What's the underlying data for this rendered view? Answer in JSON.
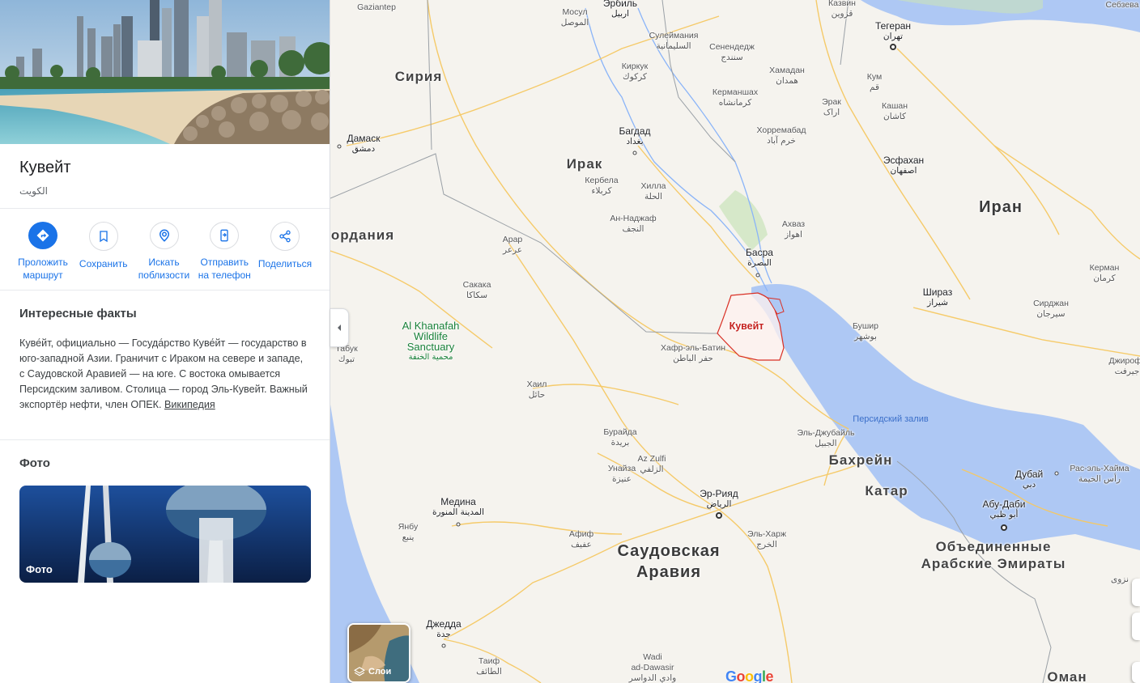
{
  "panel": {
    "title": "Кувейт",
    "subtitle": "الكويت",
    "actions": [
      {
        "label": "Проложить маршрут",
        "icon": "directions-icon"
      },
      {
        "label": "Сохранить",
        "icon": "bookmark-icon"
      },
      {
        "label": "Искать поблизости",
        "icon": "nearby-icon"
      },
      {
        "label": "Отправить на телефон",
        "icon": "send-to-phone-icon"
      },
      {
        "label": "Поделиться",
        "icon": "share-icon"
      }
    ],
    "facts": {
      "title": "Интересные факты",
      "text": "Куве́йт, официально — Госуда́рство Куве́йт — государство в юго-западной Азии. Граничит с Ираком на севере и западе, с Саудовской Аравией — на юге. С востока омывается Персидским заливом. Столица — город Эль-Кувейт. Важный экспортёр нефти, член ОПЕК.",
      "link": "Википедия"
    },
    "photos": {
      "title": "Фото",
      "card_label": "Фото"
    }
  },
  "map": {
    "labels": {
      "gaziantep": "Gaziantep",
      "erbil": "Эрбиль",
      "erbil_ar": "اربيل",
      "mosul": "Мосул",
      "mosul_ar": "الموصل",
      "kazvin": "Казвин",
      "kazvin_ar": "قزوین",
      "sebzevar": "Себзева",
      "syria": "Сирия",
      "suleymaniya": "Сулеймания",
      "suleymaniya_ar": "السليمانية",
      "senendej": "Сенендедж",
      "senendej_ar": "سنندج",
      "tehran": "Тегеран",
      "tehran_ar": "تهران",
      "kirkuk": "Киркук",
      "kirkuk_ar": "كركوك",
      "hamadan": "Хамадан",
      "hamadan_ar": "همدان",
      "kum": "Кум",
      "kum_ar": "قم",
      "kermanshah": "Керманшах",
      "kermanshah_ar": "کرمانشاه",
      "arak": "Эрак",
      "arak_ar": "اراک",
      "kashan": "Кашан",
      "kashan_ar": "کاشان",
      "damascus": "Дамаск",
      "damascus_ar": "دمشق",
      "baghdad": "Багдад",
      "baghdad_ar": "بغداد",
      "khorramabad": "Хорремабад",
      "khorramabad_ar": "خرم آباد",
      "iraq": "Ирак",
      "kerbela": "Кербела",
      "kerbela_ar": "كربلاء",
      "isfahan": "Эсфахан",
      "isfahan_ar": "اصفهان",
      "hilla": "Хилла",
      "hilla_ar": "الحلة",
      "iran": "Иран",
      "najaf": "Ан-Наджаф",
      "najaf_ar": "النجف",
      "ahvaz": "Ахваз",
      "ahvaz_ar": "اهواز",
      "jordan": "ордания",
      "arar": "Арар",
      "arar_ar": "عرعر",
      "basra": "Басра",
      "basra_ar": "البصرة",
      "kerman": "Керман",
      "kerman_ar": "كرمان",
      "sakaka": "Сакака",
      "sakaka_ar": "سكاكا",
      "shiraz": "Шираз",
      "shiraz_ar": "شیراز",
      "sirjan": "Сирджан",
      "sirjan_ar": "سیرجان",
      "khanafah": "Al Khanafah\nWildlife\nSanctuary",
      "khanafah_ar": "محمية الخنفة",
      "kuwait": "Кувейт",
      "bushehr": "Бушир",
      "bushehr_ar": "بوشهر",
      "tabuk": "Табук",
      "tabuk_ar": "تبوك",
      "hafar": "Хафр-эль-Батин",
      "hafar_ar": "حفر الباطن",
      "jiroft": "Джирофт",
      "jiroft_ar": "جیرفت",
      "hail": "Хаил",
      "hail_ar": "حائل",
      "persian_gulf": "Персидский залив",
      "jubail": "Эль-Джубайль",
      "jubail_ar": "الجبيل",
      "buraydah": "Бурайда",
      "buraydah_ar": "بريدة",
      "azzulfi": "Az Zulfi",
      "azzulfi_ar": "الزلفي",
      "bahrain": "Бахрейн",
      "unaizah": "Унайза",
      "unaizah_ar": "عنيزة",
      "dubai": "Дубай",
      "dubai_ar": "دبي",
      "ras_al_khaimah": "Рас-эль-Хайма",
      "ras_al_khaimah_ar": "رأس الخيمة",
      "qatar": "Катар",
      "riyadh": "Эр-Рияд",
      "riyadh_ar": "الرياض",
      "medina": "Медина",
      "medina_ar": "المدينة المنورة",
      "abu_dhabi": "Абу-Даби",
      "abu_dhabi_ar": "أبو ظبي",
      "yanbu": "Янбу",
      "yanbu_ar": "ينبع",
      "afif": "Афиф",
      "afif_ar": "عفيف",
      "al_kharj": "Эль-Харж",
      "al_kharj_ar": "الخرج",
      "uae": "Объединенные\nАрабские Эмираты",
      "saudi": "Саудовская\nАравия",
      "nizwa_ar": "نزوى",
      "jeddah": "Джедда",
      "jeddah_ar": "جدة",
      "taif": "Таиф",
      "taif_ar": "الطائف",
      "wadi": "Wadi\nad-Dawasir",
      "wadi_ar": "وادي الدواسر",
      "oman": "Оман"
    },
    "layers_label": "Слои",
    "google": [
      "G",
      "o",
      "o",
      "g",
      "l",
      "e"
    ]
  },
  "colors": {
    "accent": "#1a73e8",
    "water": "#8ab4f8",
    "land": "#f5f3ee",
    "road": "#f5c862",
    "kuwait_border": "#d93025"
  }
}
